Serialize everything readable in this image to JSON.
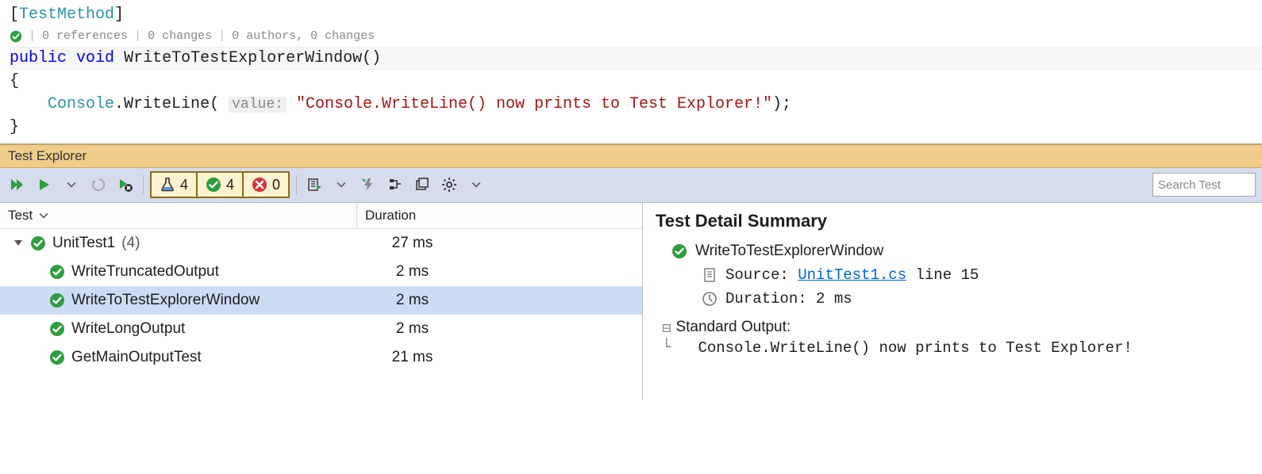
{
  "editor": {
    "attr_open": "[",
    "attr_name": "TestMethod",
    "attr_close": "]",
    "codelens": {
      "refs": "0 references",
      "changes": "0 changes",
      "authors": "0 authors, 0 changes"
    },
    "sig_public": "public",
    "sig_void": "void",
    "sig_name": "WriteToTestExplorerWindow",
    "sig_parens": "()",
    "brace_open": "{",
    "call_target": "Console",
    "call_dot": ".",
    "call_method": "WriteLine",
    "call_open": "(",
    "param_hint": "value:",
    "call_string": "\"Console.WriteLine() now prints to Test Explorer!\"",
    "call_close": ");",
    "brace_close": "}"
  },
  "testExplorer": {
    "title": "Test Explorer",
    "counts": {
      "total": "4",
      "passed": "4",
      "failed": "0"
    },
    "search_placeholder": "Search Test",
    "columns": {
      "test": "Test",
      "duration": "Duration"
    },
    "group": {
      "name": "UnitTest1",
      "count": "(4)",
      "duration": "27 ms"
    },
    "tests": [
      {
        "name": "WriteTruncatedOutput",
        "duration": "2 ms",
        "selected": false
      },
      {
        "name": "WriteToTestExplorerWindow",
        "duration": "2 ms",
        "selected": true
      },
      {
        "name": "WriteLongOutput",
        "duration": "2 ms",
        "selected": false
      },
      {
        "name": "GetMainOutputTest",
        "duration": "21 ms",
        "selected": false
      }
    ],
    "detail": {
      "heading": "Test Detail Summary",
      "test_name": "WriteToTestExplorerWindow",
      "source_label": "Source:",
      "source_file": "UnitTest1.cs",
      "source_line": "line 15",
      "duration_label": "Duration:",
      "duration_value": "2 ms",
      "stdout_label": "Standard Output:",
      "stdout_text": "Console.WriteLine() now prints to Test Explorer!"
    }
  }
}
